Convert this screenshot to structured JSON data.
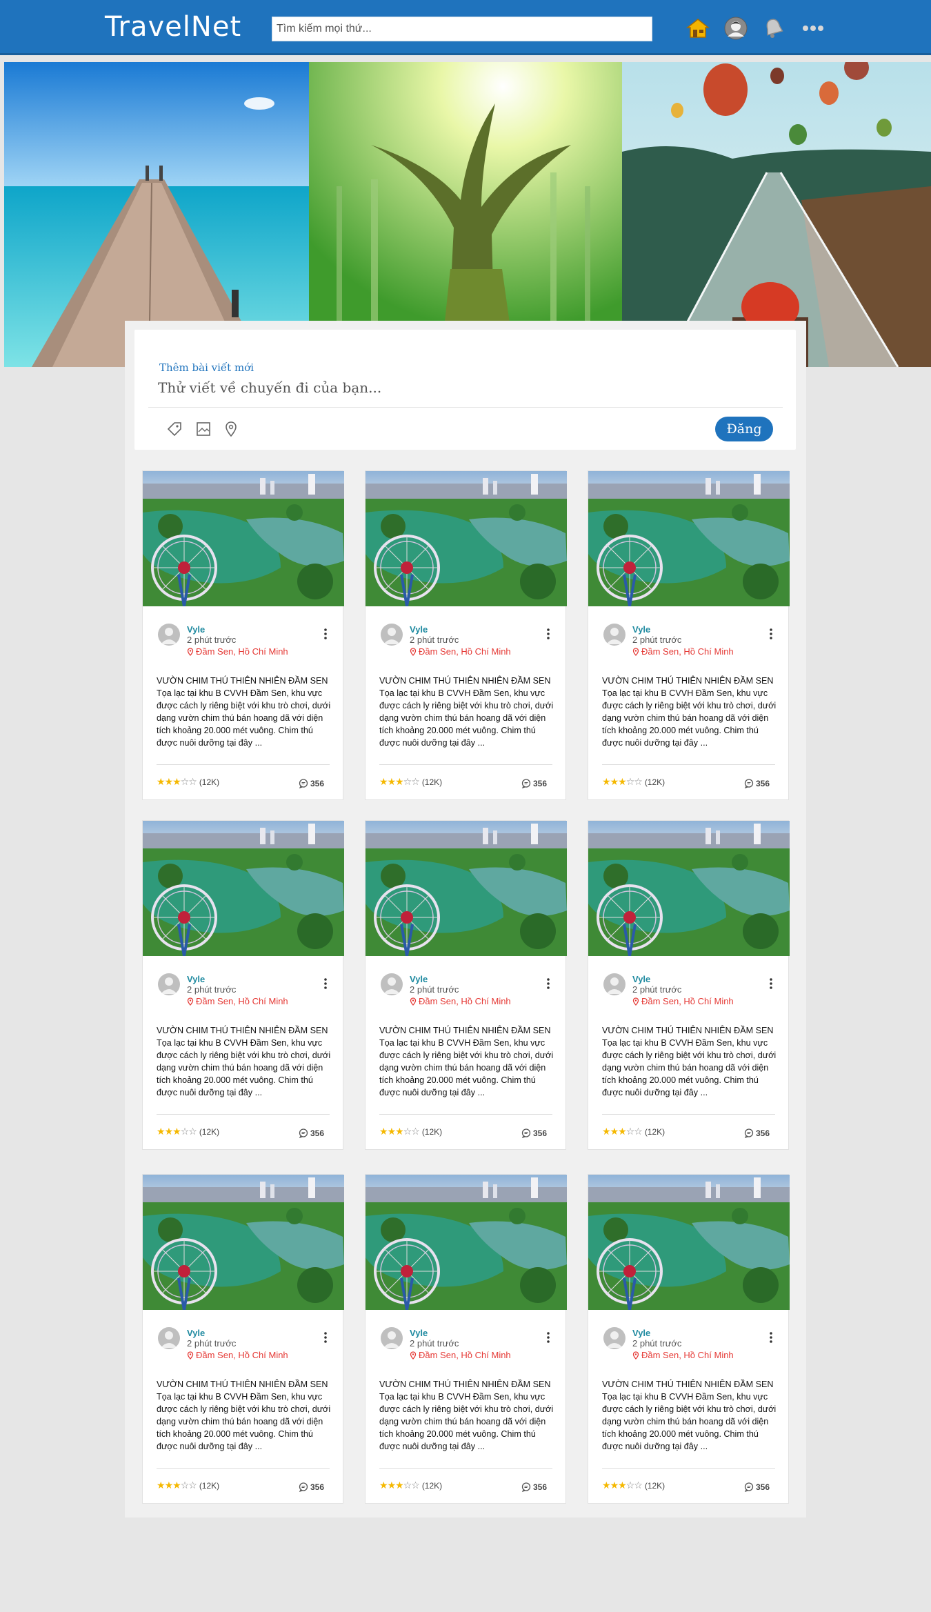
{
  "header": {
    "logo": "TravelNet",
    "search_placeholder": "Tìm kiếm mọi thứ...",
    "icons": [
      "home-icon",
      "avatar-icon",
      "bell-icon",
      "more-icon"
    ]
  },
  "banner": {
    "images": [
      "ocean-pier",
      "forest-tree",
      "balloons-bridge"
    ]
  },
  "composer": {
    "title": "Thêm bài viết mới",
    "placeholder": "Thử viết về chuyến đi của bạn...",
    "tools": [
      "tag-icon",
      "image-icon",
      "location-icon"
    ],
    "post_label": "Đăng"
  },
  "colors": {
    "brand": "#1f73bd",
    "username": "#1f8aa0",
    "location": "#e53935",
    "star": "#f5b800"
  },
  "posts": [
    {
      "user": "Vyle",
      "time": "2 phút trước",
      "location": "Đầm Sen, Hồ Chí Minh",
      "text": "VƯỜN CHIM THÚ THIÊN NHIÊN ĐẦM SEN Tọa lạc tại khu B CVVH Đầm Sen, khu vực được cách ly riêng biệt với khu trò chơi, dưới dạng vườn chim thú bán hoang dã với diện tích khoảng 20.000 mét vuông. Chim thú được nuôi dưỡng tại đây ...",
      "rating": 3,
      "rating_max": 5,
      "rating_count": "(12K)",
      "comments": "356"
    },
    {
      "user": "Vyle",
      "time": "2 phút trước",
      "location": "Đầm Sen, Hồ Chí Minh",
      "text": "VƯỜN CHIM THÚ THIÊN NHIÊN ĐẦM SEN Tọa lạc tại khu B CVVH Đầm Sen, khu vực được cách ly riêng biệt với khu trò chơi, dưới dạng vườn chim thú bán hoang dã với diện tích khoảng 20.000 mét vuông. Chim thú được nuôi dưỡng tại đây ...",
      "rating": 3,
      "rating_max": 5,
      "rating_count": "(12K)",
      "comments": "356"
    },
    {
      "user": "Vyle",
      "time": "2 phút trước",
      "location": "Đầm Sen, Hồ Chí Minh",
      "text": "VƯỜN CHIM THÚ THIÊN NHIÊN ĐẦM SEN Tọa lạc tại khu B CVVH Đầm Sen, khu vực được cách ly riêng biệt với khu trò chơi, dưới dạng vườn chim thú bán hoang dã với diện tích khoảng 20.000 mét vuông. Chim thú được nuôi dưỡng tại đây ...",
      "rating": 3,
      "rating_max": 5,
      "rating_count": "(12K)",
      "comments": "356"
    },
    {
      "user": "Vyle",
      "time": "2 phút trước",
      "location": "Đầm Sen, Hồ Chí Minh",
      "text": "VƯỜN CHIM THÚ THIÊN NHIÊN ĐẦM SEN Tọa lạc tại khu B CVVH Đầm Sen, khu vực được cách ly riêng biệt với khu trò chơi, dưới dạng vườn chim thú bán hoang dã với diện tích khoảng 20.000 mét vuông. Chim thú được nuôi dưỡng tại đây ...",
      "rating": 3,
      "rating_max": 5,
      "rating_count": "(12K)",
      "comments": "356"
    },
    {
      "user": "Vyle",
      "time": "2 phút trước",
      "location": "Đầm Sen, Hồ Chí Minh",
      "text": "VƯỜN CHIM THÚ THIÊN NHIÊN ĐẦM SEN Tọa lạc tại khu B CVVH Đầm Sen, khu vực được cách ly riêng biệt với khu trò chơi, dưới dạng vườn chim thú bán hoang dã với diện tích khoảng 20.000 mét vuông. Chim thú được nuôi dưỡng tại đây ...",
      "rating": 3,
      "rating_max": 5,
      "rating_count": "(12K)",
      "comments": "356"
    },
    {
      "user": "Vyle",
      "time": "2 phút trước",
      "location": "Đầm Sen, Hồ Chí Minh",
      "text": "VƯỜN CHIM THÚ THIÊN NHIÊN ĐẦM SEN Tọa lạc tại khu B CVVH Đầm Sen, khu vực được cách ly riêng biệt với khu trò chơi, dưới dạng vườn chim thú bán hoang dã với diện tích khoảng 20.000 mét vuông. Chim thú được nuôi dưỡng tại đây ...",
      "rating": 3,
      "rating_max": 5,
      "rating_count": "(12K)",
      "comments": "356"
    },
    {
      "user": "Vyle",
      "time": "2 phút trước",
      "location": "Đầm Sen, Hồ Chí Minh",
      "text": "VƯỜN CHIM THÚ THIÊN NHIÊN ĐẦM SEN Tọa lạc tại khu B CVVH Đầm Sen, khu vực được cách ly riêng biệt với khu trò chơi, dưới dạng vườn chim thú bán hoang dã với diện tích khoảng 20.000 mét vuông. Chim thú được nuôi dưỡng tại đây ...",
      "rating": 3,
      "rating_max": 5,
      "rating_count": "(12K)",
      "comments": "356"
    },
    {
      "user": "Vyle",
      "time": "2 phút trước",
      "location": "Đầm Sen, Hồ Chí Minh",
      "text": "VƯỜN CHIM THÚ THIÊN NHIÊN ĐẦM SEN Tọa lạc tại khu B CVVH Đầm Sen, khu vực được cách ly riêng biệt với khu trò chơi, dưới dạng vườn chim thú bán hoang dã với diện tích khoảng 20.000 mét vuông. Chim thú được nuôi dưỡng tại đây ...",
      "rating": 3,
      "rating_max": 5,
      "rating_count": "(12K)",
      "comments": "356"
    },
    {
      "user": "Vyle",
      "time": "2 phút trước",
      "location": "Đầm Sen, Hồ Chí Minh",
      "text": "VƯỜN CHIM THÚ THIÊN NHIÊN ĐẦM SEN Tọa lạc tại khu B CVVH Đầm Sen, khu vực được cách ly riêng biệt với khu trò chơi, dưới dạng vườn chim thú bán hoang dã với diện tích khoảng 20.000 mét vuông. Chim thú được nuôi dưỡng tại đây ...",
      "rating": 3,
      "rating_max": 5,
      "rating_count": "(12K)",
      "comments": "356"
    }
  ]
}
